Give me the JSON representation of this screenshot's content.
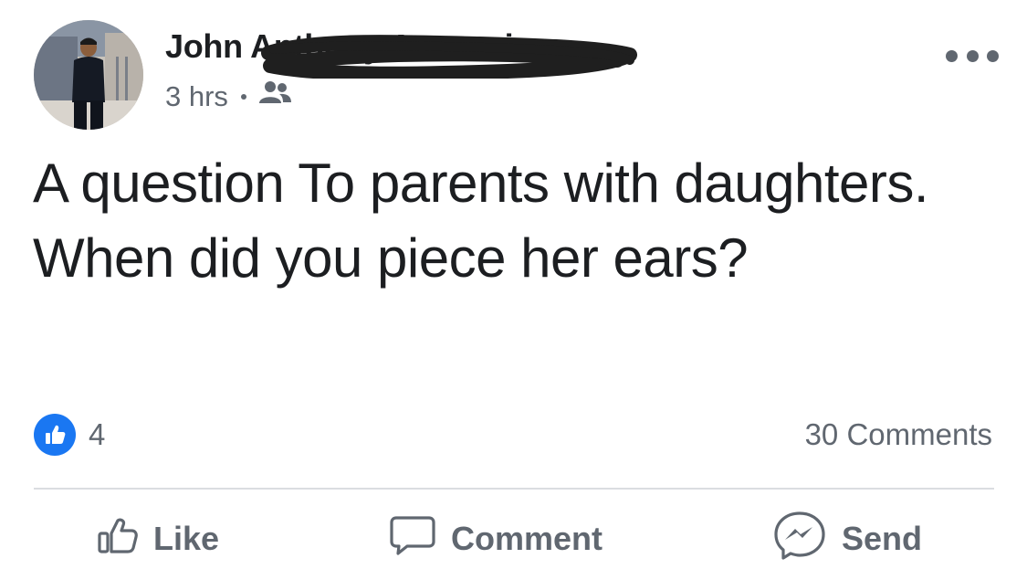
{
  "post": {
    "author_name": "John Anthony Ascencio",
    "timestamp": "3 hrs",
    "audience_icon": "friends-icon",
    "more_icon": "more-options-icon",
    "text": "A question To parents with daughters. When did you piece her ears?"
  },
  "reactions": {
    "icon": "like-reaction-icon",
    "count": "4"
  },
  "comments": {
    "count_label": "30 Comments"
  },
  "actions": {
    "like_label": "Like",
    "comment_label": "Comment",
    "send_label": "Send"
  },
  "colors": {
    "accent": "#1a77f2",
    "text_primary": "#1c1e21",
    "text_secondary": "#606770",
    "divider": "#dadde1",
    "redaction": "#1f1f1f"
  }
}
